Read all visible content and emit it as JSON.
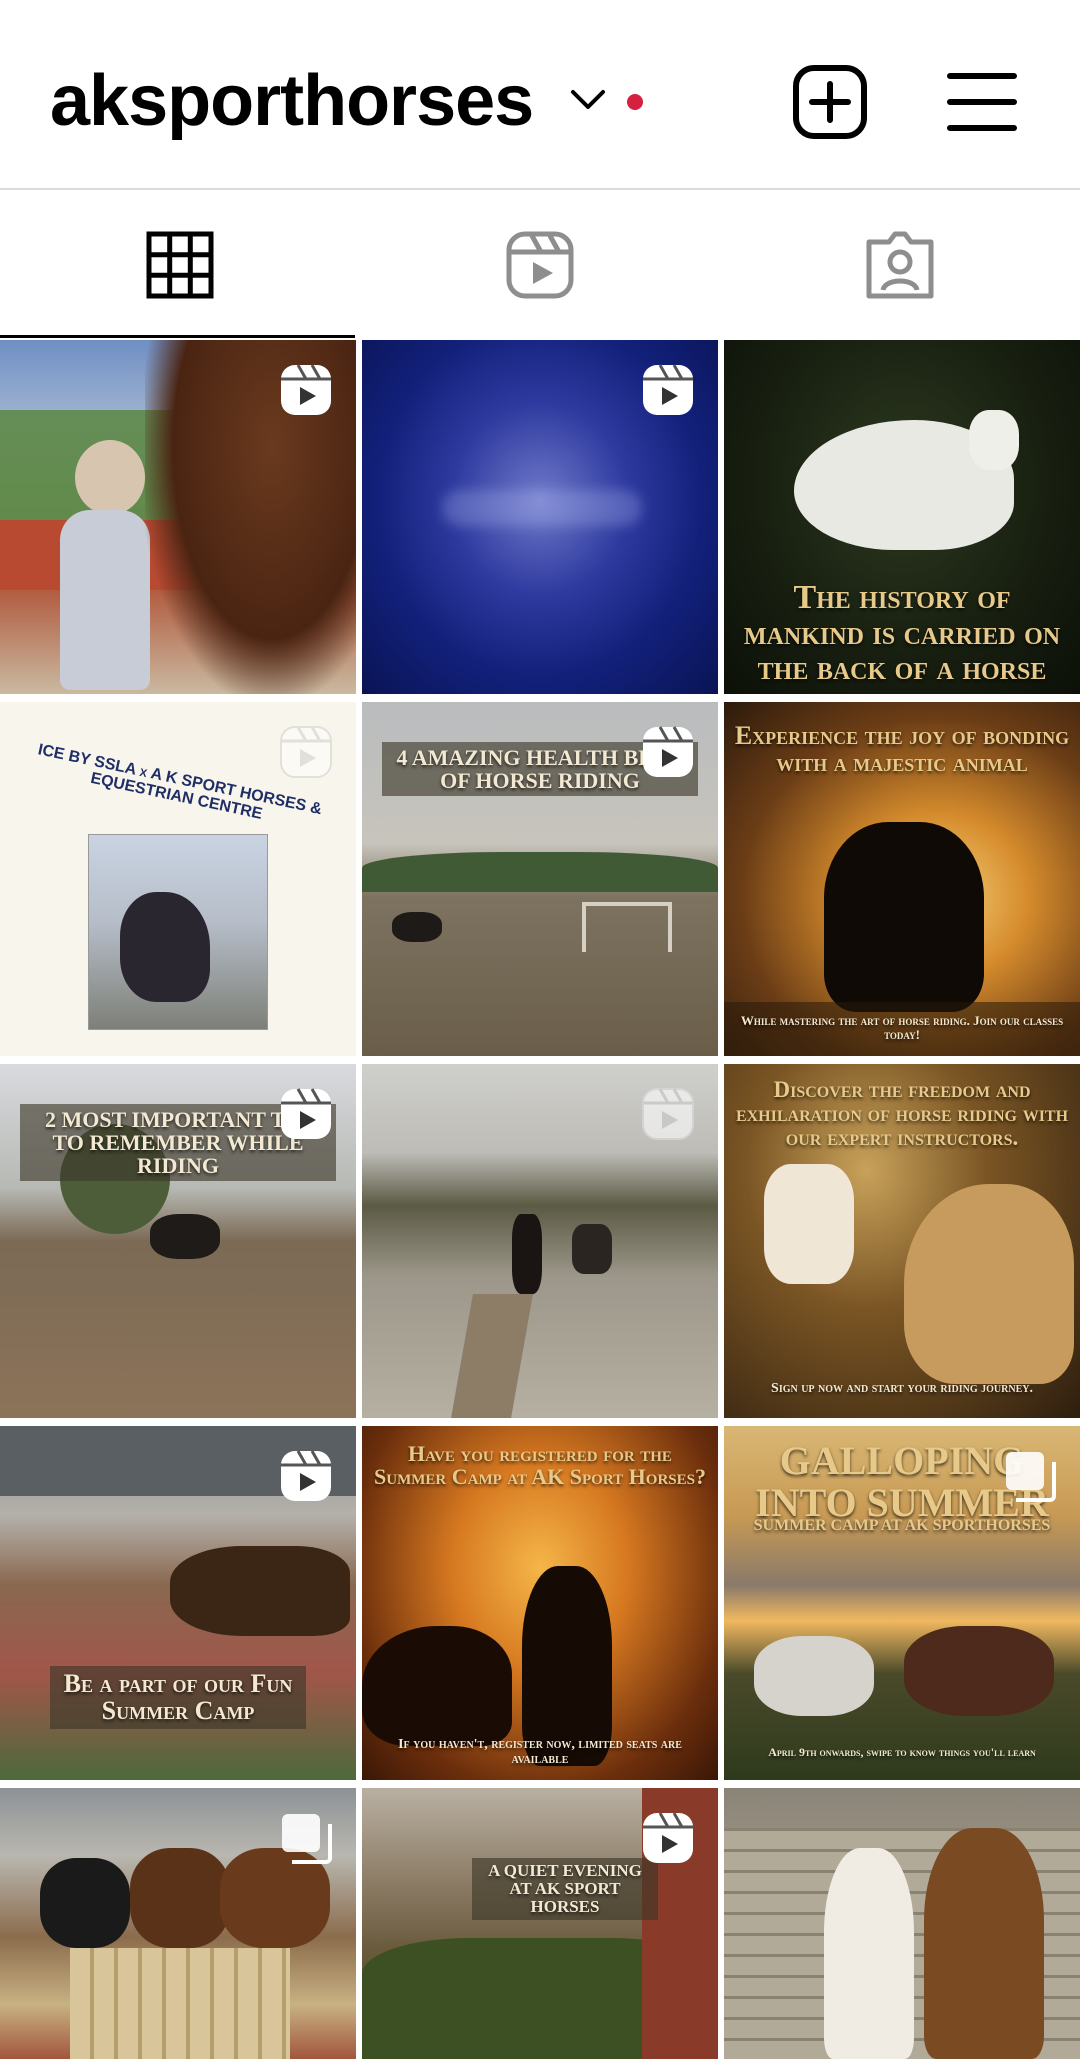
{
  "header": {
    "username": "aksporthorses",
    "icons": {
      "dropdown": "chevron-down-icon",
      "notification": "red-dot-icon",
      "create": "plus-square-icon",
      "menu": "hamburger-menu-icon"
    },
    "colors": {
      "notification_dot": "#d6203f",
      "divider": "#dbdbdb"
    }
  },
  "tabs": [
    {
      "name": "posts-grid",
      "icon": "grid-icon",
      "active": true
    },
    {
      "name": "reels",
      "icon": "reels-icon",
      "active": false
    },
    {
      "name": "tagged",
      "icon": "tagged-person-icon",
      "active": false
    }
  ],
  "posts": [
    {
      "type": "reel",
      "text": ""
    },
    {
      "type": "reel",
      "text": ""
    },
    {
      "type": "image",
      "text": "The history of mankind is carried on the back of a horse"
    },
    {
      "type": "reel",
      "text": "ICE BY SSLA x A K SPORT HORSES & EQUESTRIAN CENTRE"
    },
    {
      "type": "reel",
      "text": "4 AMAZING HEALTH BENE OF HORSE RIDING"
    },
    {
      "type": "image",
      "title": "Experience the joy of bonding with a majestic animal",
      "caption": "While mastering the art of horse riding. Join our classes today!"
    },
    {
      "type": "reel",
      "text": "2 MOST IMPORTANT THI TO REMEMBER WHILE RIDING"
    },
    {
      "type": "reel",
      "text": ""
    },
    {
      "type": "image",
      "title": "Discover the freedom and exhilaration of horse riding with our expert instructors.",
      "caption": "Sign up now and start your riding journey."
    },
    {
      "type": "reel",
      "text": "Be a part of our Fun Summer Camp"
    },
    {
      "type": "image",
      "title": "Have you registered for the Summer Camp at AK Sport Horses?",
      "caption": "If you haven't, register now, limited seats are available"
    },
    {
      "type": "carousel",
      "title": "GALLOPING INTO SUMMER",
      "subtitle": "SUMMER CAMP AT AK SPORTHORSES",
      "caption": "April 9th onwards, swipe to know things you'll learn"
    },
    {
      "type": "carousel",
      "text": ""
    },
    {
      "type": "reel",
      "text": "A QUIET EVENING AT AK SPORT HORSES"
    },
    {
      "type": "image",
      "text": ""
    }
  ]
}
